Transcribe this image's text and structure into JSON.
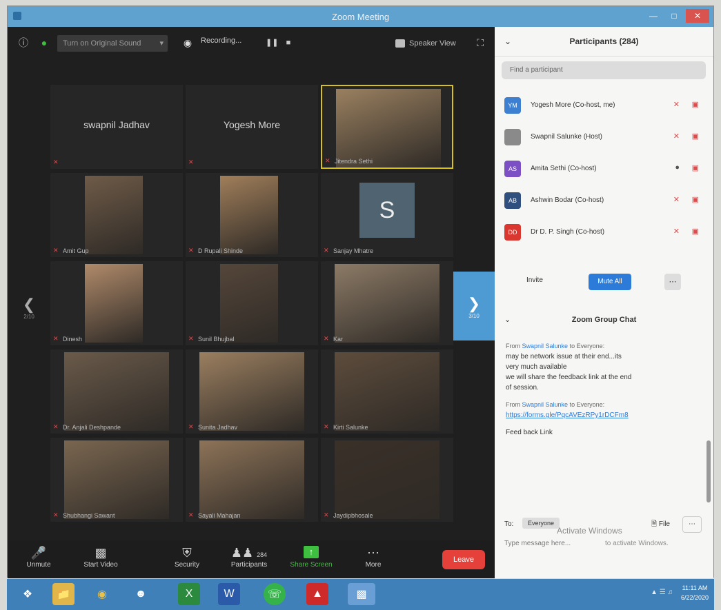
{
  "window": {
    "title": "Zoom Meeting"
  },
  "topbar": {
    "original_sound": "Turn on Original Sound",
    "recording": "Recording...",
    "speaker_view": "Speaker View"
  },
  "tiles": [
    {
      "name": "",
      "bigname": "swapnil Jadhav",
      "video": false
    },
    {
      "name": "",
      "bigname": "Yogesh More",
      "video": false
    },
    {
      "name": "Jitendra Sethi",
      "bigname": "",
      "video": true,
      "active": true
    },
    {
      "name": "Amit Gup",
      "bigname": "",
      "video": true
    },
    {
      "name": "D Rupali Shinde",
      "bigname": "",
      "video": true
    },
    {
      "name": "Sanjay Mhatre",
      "bigname": "",
      "video": false,
      "avatar": "S"
    },
    {
      "name": "Dinesh",
      "bigname": "",
      "video": true
    },
    {
      "name": "Sunil Bhujbal",
      "bigname": "",
      "video": true
    },
    {
      "name": "Kar",
      "bigname": "",
      "video": true
    },
    {
      "name": "Dr. Anjali Deshpande",
      "bigname": "",
      "video": true
    },
    {
      "name": "Sunita Jadhav",
      "bigname": "",
      "video": true
    },
    {
      "name": "Kirti Salunke",
      "bigname": "",
      "video": true
    },
    {
      "name": "Shubhangi Sawant",
      "bigname": "",
      "video": true
    },
    {
      "name": "Sayali Mahajan",
      "bigname": "",
      "video": true
    },
    {
      "name": "Jaydipbhosale",
      "bigname": "",
      "video": true
    }
  ],
  "nav": {
    "left_page": "2/10",
    "right_page": "3/10"
  },
  "bottombar": {
    "unmute": "Unmute",
    "start_video": "Start Video",
    "security": "Security",
    "participants": "Participants",
    "participant_count": "284",
    "share_screen": "Share Screen",
    "more": "More",
    "leave": "Leave"
  },
  "participants_panel": {
    "title": "Participants (284)",
    "search_placeholder": "Find a participant",
    "list": [
      {
        "initials": "YM",
        "name": "Yogesh More (Co-host, me)",
        "color": "#3d7fd0",
        "mic": "muted"
      },
      {
        "initials": "",
        "name": "Swapnil Salunke (Host)",
        "color": "#8a8a8a",
        "mic": "muted"
      },
      {
        "initials": "AS",
        "name": "Amita Sethi (Co-host)",
        "color": "#7c4fc4",
        "mic": "on"
      },
      {
        "initials": "AB",
        "name": "Ashwin Bodar (Co-host)",
        "color": "#2f4f7f",
        "mic": "muted"
      },
      {
        "initials": "DD",
        "name": "Dr D. P. Singh (Co-host)",
        "color": "#d9372f",
        "mic": "muted"
      }
    ],
    "invite": "Invite",
    "mute_all": "Mute All"
  },
  "chat": {
    "title": "Zoom Group Chat",
    "messages": [
      {
        "from_prefix": "From",
        "from_name": "Swapnil Salunke",
        "from_to": "to Everyone:",
        "lines": [
          "may be network issue at their end...its",
          "very much available",
          "we will share the feedback link at the end",
          "of session."
        ]
      },
      {
        "from_prefix": "From",
        "from_name": "Swapnil Salunke",
        "from_to": "to Everyone:",
        "link": "https://forms.gle/PqcAVEzRPy1rDCFm8",
        "after": "Feed back Link"
      }
    ],
    "to_label": "To:",
    "to_value": "Everyone",
    "file": "File",
    "input_placeholder": "Type message here...",
    "activate": "Activate Windows",
    "activate_sub": "to activate Windows."
  },
  "taskbar": {
    "time": "11:11 AM",
    "date": "6/22/2020"
  }
}
